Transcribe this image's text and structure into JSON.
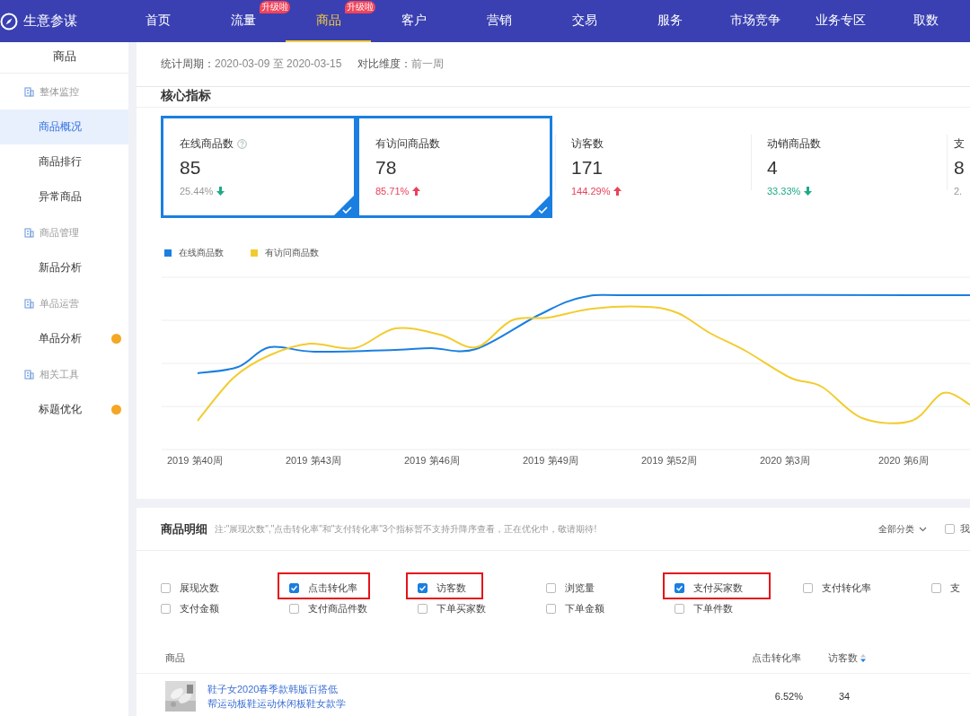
{
  "app": {
    "title": "生意参谋"
  },
  "nav": [
    {
      "label": "首页",
      "selected": false
    },
    {
      "label": "流量",
      "selected": false,
      "badge": "升级啦"
    },
    {
      "label": "商品",
      "selected": true,
      "badge": "升级啦"
    },
    {
      "label": "客户",
      "selected": false
    },
    {
      "label": "营销",
      "selected": false
    },
    {
      "label": "交易",
      "selected": false
    },
    {
      "label": "服务",
      "selected": false
    },
    {
      "label": "市场竞争",
      "selected": false
    },
    {
      "label": "业务专区",
      "selected": false
    },
    {
      "label": "取数",
      "selected": false
    }
  ],
  "sidebar": {
    "title": "商品",
    "groups": [
      {
        "label": "整体监控",
        "items": [
          {
            "label": "商品概况",
            "selected": true,
            "dot": false
          },
          {
            "label": "商品排行",
            "selected": false,
            "dot": false
          },
          {
            "label": "异常商品",
            "selected": false,
            "dot": false
          }
        ]
      },
      {
        "label": "商品管理",
        "items": [
          {
            "label": "新品分析",
            "selected": false,
            "dot": false
          }
        ]
      },
      {
        "label": "单品运营",
        "items": [
          {
            "label": "单品分析",
            "selected": false,
            "dot": true
          }
        ]
      },
      {
        "label": "相关工具",
        "items": [
          {
            "label": "标题优化",
            "selected": false,
            "dot": true
          }
        ]
      }
    ]
  },
  "filter_bar": {
    "period_label": "统计周期：",
    "period": "2020-03-09 至 2020-03-15",
    "compare_label": "对比维度：",
    "compare": "前一周"
  },
  "core": {
    "title": "核心指标",
    "metrics": [
      {
        "label": "在线商品数",
        "help": true,
        "value": "85",
        "change": "25.44%",
        "increase": false,
        "color": "#999999",
        "selected": true
      },
      {
        "label": "有访问商品数",
        "help": false,
        "value": "78",
        "change": "85.71%",
        "increase": true,
        "color": "#e8425a",
        "selected": true
      },
      {
        "label": "访客数",
        "help": false,
        "value": "171",
        "change": "144.29%",
        "increase": true,
        "color": "#e8425a",
        "selected": false
      },
      {
        "label": "动销商品数",
        "help": false,
        "value": "4",
        "change": "33.33%",
        "increase": false,
        "color": "#1dab86",
        "selected": false
      },
      {
        "label": "支",
        "help": false,
        "value": "8",
        "change": "2.",
        "color": "#999999",
        "selected": false
      }
    ],
    "chart": {
      "legend": [
        {
          "label": "在线商品数",
          "color": "#1a7fe0"
        },
        {
          "label": "有访问商品数",
          "color": "#f2cc2f"
        }
      ],
      "x_labels": [
        "2019 第40周",
        "2019 第43周",
        "2019 第46周",
        "2019 第49周",
        "2019 第52周",
        "2020 第3周",
        "2020 第6周"
      ]
    }
  },
  "detail": {
    "title": "商品明细",
    "note": "注:\"展现次数\",\"点击转化率\"和\"支付转化率\"3个指标暂不支持升降序查看，正在优化中，敬请期待!",
    "category": "全部分类",
    "extra_option": {
      "label": "我",
      "checked": false
    },
    "filters": [
      {
        "label": "展现次数",
        "checked": false,
        "highlighted": false
      },
      {
        "label": "点击转化率",
        "checked": true,
        "highlighted": true
      },
      {
        "label": "访客数",
        "checked": true,
        "highlighted": true
      },
      {
        "label": "浏览量",
        "checked": false,
        "highlighted": false
      },
      {
        "label": "支付买家数",
        "checked": true,
        "highlighted": true
      },
      {
        "label": "支付转化率",
        "checked": false,
        "highlighted": false
      },
      {
        "label": "支",
        "checked": false,
        "highlighted": false
      },
      {
        "label": "支付金额",
        "checked": false,
        "highlighted": false
      },
      {
        "label": "支付商品件数",
        "checked": false,
        "highlighted": false
      },
      {
        "label": "下单买家数",
        "checked": false,
        "highlighted": false
      },
      {
        "label": "下单金额",
        "checked": false,
        "highlighted": false
      },
      {
        "label": "下单件数",
        "checked": false,
        "highlighted": false
      }
    ],
    "table": {
      "columns": [
        {
          "label": "商品",
          "sortable": false
        },
        {
          "label": "点击转化率",
          "sortable": false
        },
        {
          "label": "访客数",
          "sortable": true
        }
      ],
      "rows": [
        {
          "title": "鞋子女2020春季款韩版百搭低帮运动板鞋运动休闲板鞋女款学",
          "click_rate": "6.52%",
          "visitors": "34"
        }
      ]
    }
  }
}
